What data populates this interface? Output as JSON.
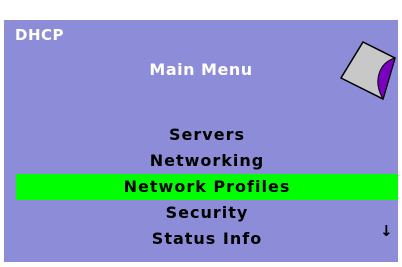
{
  "app": {
    "title": "DHCP"
  },
  "menu": {
    "title": "Main Menu",
    "items": [
      {
        "label": "Servers",
        "selected": false
      },
      {
        "label": "Networking",
        "selected": false
      },
      {
        "label": "Network Profiles",
        "selected": true
      },
      {
        "label": "Security",
        "selected": false
      },
      {
        "label": "Status Info",
        "selected": false
      }
    ],
    "scroll_indicator": "↓"
  },
  "icons": {
    "logo": "diamond-logo-icon",
    "scroll": "down-arrow-icon"
  },
  "colors": {
    "screen_bg": "#8c8cd8",
    "selection": "#00ff00",
    "logo_face": "#c8c8c8",
    "logo_accent": "#7a00c0"
  }
}
